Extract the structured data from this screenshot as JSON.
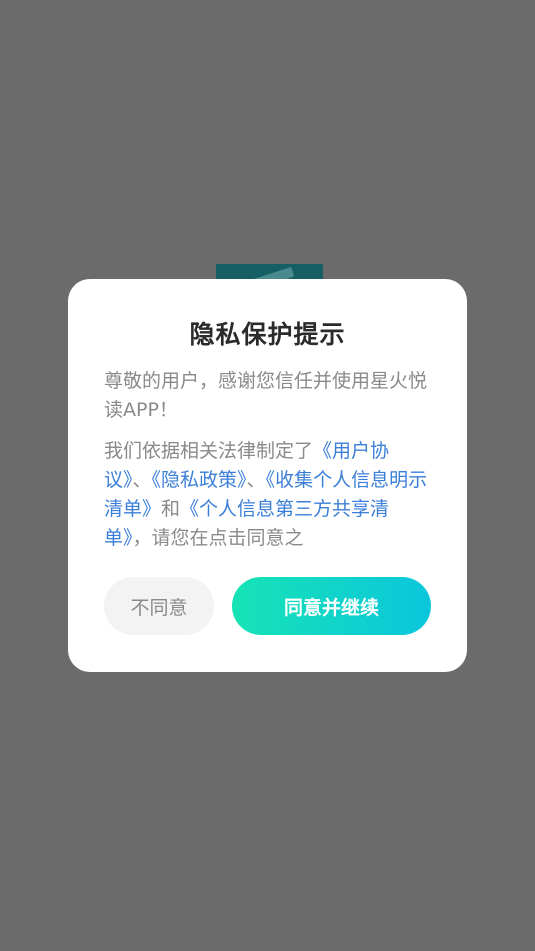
{
  "dialog": {
    "title": "隐私保护提示",
    "greeting": "尊敬的用户，感谢您信任并使用星火悦读APP！",
    "body": {
      "t1": "我们依据相关法律制定了",
      "l1": "《用户协议》",
      "t2": "、",
      "l2": "《隐私政策》",
      "t3": "、",
      "l3": "《收集个人信息明示清单》",
      "t4": "和",
      "l4": "《个人信息第三方共享清单》",
      "t5": "，请您在点击同意之"
    },
    "decline_label": "不同意",
    "accept_label": "同意并继续"
  },
  "colors": {
    "overlay": "#6b6b6b",
    "link": "#3b7fd9",
    "accent_start": "#16e3b5",
    "accent_end": "#0bc6dc"
  }
}
